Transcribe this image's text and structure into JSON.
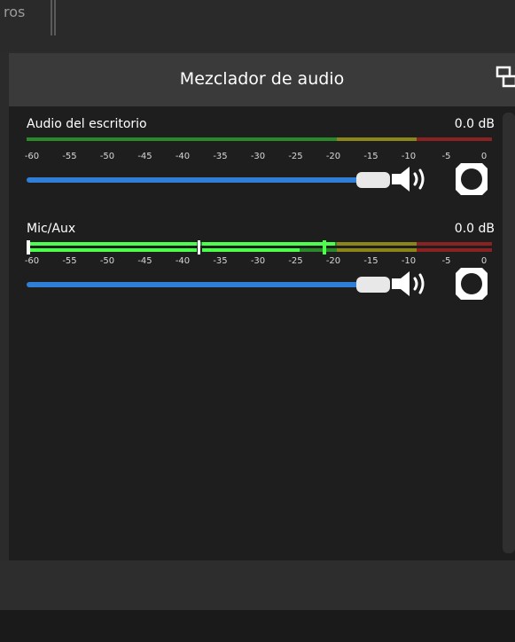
{
  "window": {
    "prev_tab_label": "ros"
  },
  "dock": {
    "title": "Mezclador de audio"
  },
  "channels": [
    {
      "name": "Audio del escritorio",
      "level": "0.0 dB",
      "volume_fraction": 0.96,
      "muted": false
    },
    {
      "name": "Mic/Aux",
      "level": "0.0 dB",
      "volume_fraction": 0.96,
      "muted": false
    }
  ],
  "meter_scale": [
    "-60",
    "-55",
    "-50",
    "-45",
    "-40",
    "-35",
    "-30",
    "-25",
    "-20",
    "-15",
    "-10",
    "-5",
    "0"
  ],
  "colors": {
    "meter_green": "#2eb82e",
    "meter_yellow": "#a8a41c",
    "meter_red": "#a82c2c",
    "meter_active_green": "#4cff4c",
    "slider_track": "#2e7fd5"
  }
}
